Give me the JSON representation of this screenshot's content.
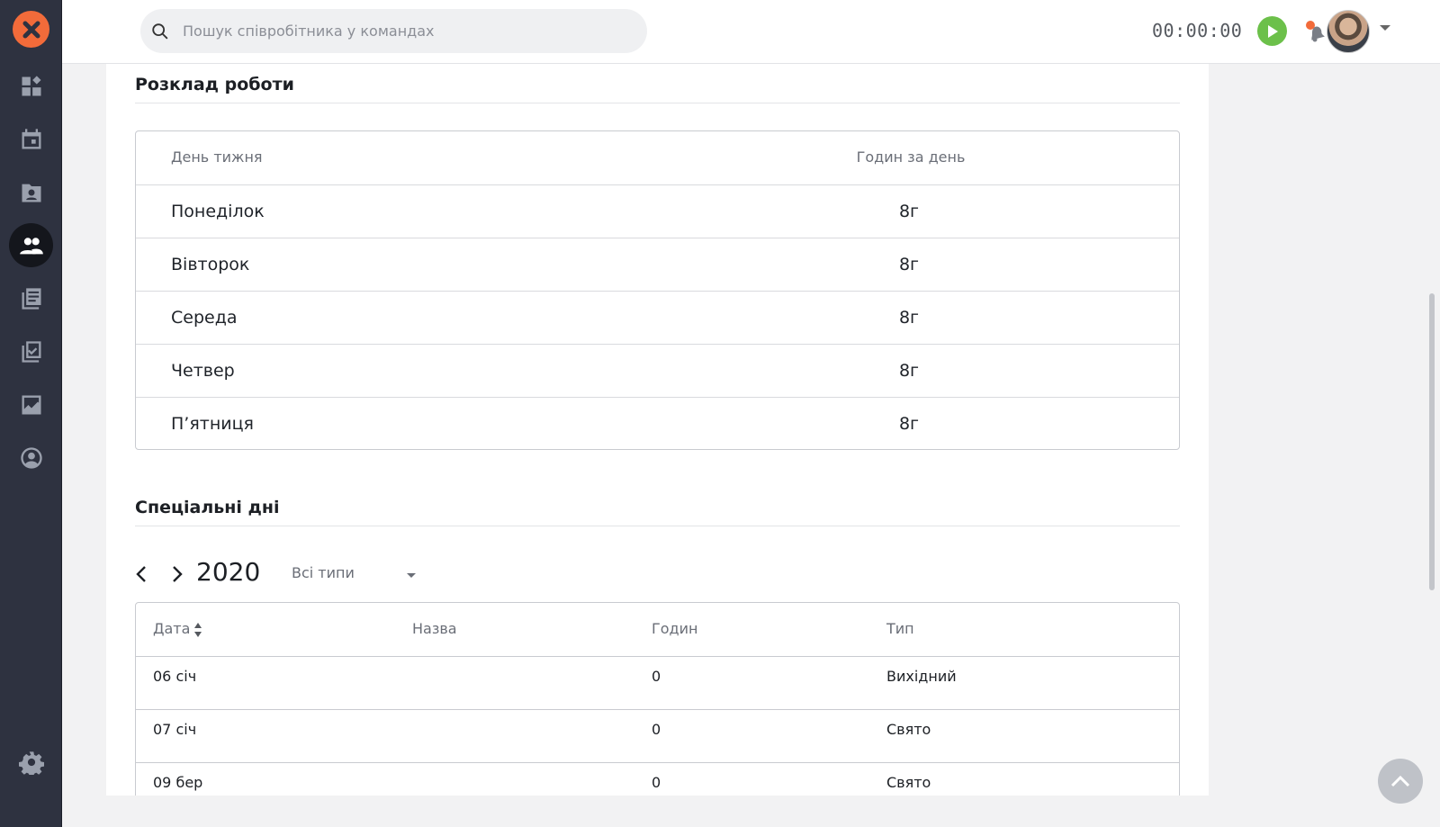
{
  "search": {
    "placeholder": "Пошук співробітника у командах"
  },
  "timer": {
    "value": "00:00:00"
  },
  "schedule": {
    "title": "Розклад роботи",
    "headers": {
      "day": "День тижня",
      "hours": "Годин за день"
    },
    "rows": [
      {
        "day": "Понеділок",
        "hours": "8г"
      },
      {
        "day": "Вівторок",
        "hours": "8г"
      },
      {
        "day": "Середа",
        "hours": "8г"
      },
      {
        "day": "Четвер",
        "hours": "8г"
      },
      {
        "day": "П’ятниця",
        "hours": "8г"
      }
    ]
  },
  "special_days": {
    "title": "Спеціальні дні",
    "year": "2020",
    "type_filter": "Всі типи",
    "headers": {
      "date": "Дата",
      "name": "Назва",
      "hours": "Годин",
      "type": "Тип"
    },
    "rows": [
      {
        "date": "06 січ",
        "name": "",
        "hours": "0",
        "type": "Вихідний"
      },
      {
        "date": "07 січ",
        "name": "",
        "hours": "0",
        "type": "Свято"
      },
      {
        "date": "09 бер",
        "name": "",
        "hours": "0",
        "type": "Свято"
      }
    ]
  },
  "colors": {
    "sidebar": "#2e3240",
    "accent_logo": "#f26b3a",
    "play": "#6cc04a"
  },
  "icons": [
    "logo-icon",
    "dashboard-icon",
    "calendar-icon",
    "contacts-icon",
    "team-icon",
    "documents-icon",
    "tasks-icon",
    "reports-icon",
    "profile-icon",
    "settings-icon",
    "search-icon",
    "play-icon",
    "bell-icon",
    "chevron-up-icon"
  ]
}
